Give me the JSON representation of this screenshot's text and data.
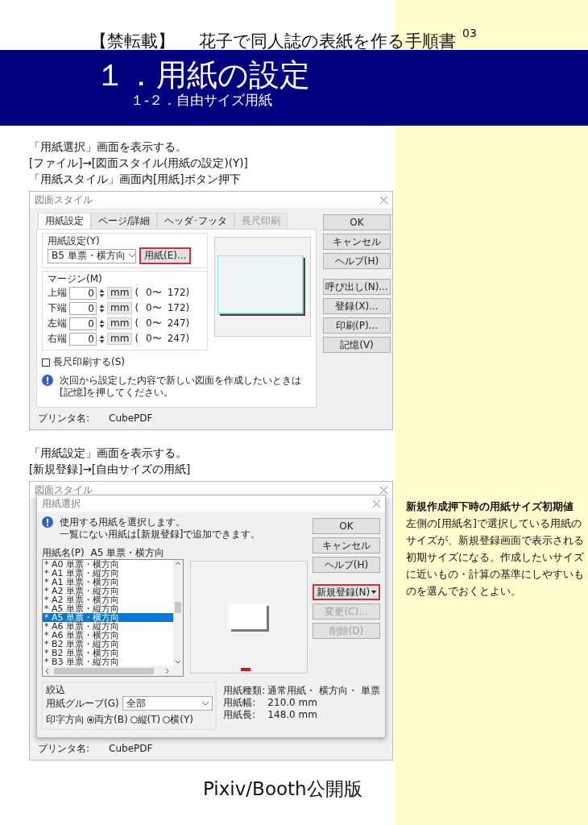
{
  "header": {
    "tag": "【禁転載】",
    "title": "花子で同人誌の表紙を作る手順書",
    "page_number": "03",
    "heading": "１．用紙の設定",
    "subheading": "１-２．自由サイズ用紙"
  },
  "section_1": {
    "instructions": [
      "「用紙選択」画面を表示する。",
      "[ファイル]→[図面スタイル(用紙の設定)(Y)]",
      "「用紙スタイル」画面内[用紙]ボタン押下"
    ],
    "dialog": {
      "title": "図面スタイル",
      "tabs": [
        {
          "label": "用紙設定",
          "selected": true,
          "disabled": false
        },
        {
          "label": "ページ/詳細",
          "selected": false,
          "disabled": false
        },
        {
          "label": "ヘッダ･フッタ",
          "selected": false,
          "disabled": false
        },
        {
          "label": "長尺印刷",
          "selected": false,
          "disabled": true
        }
      ],
      "paper_group": "用紙設定(Y)",
      "paper_value": "B5 単票・横方向",
      "paper_button": {
        "label": "用紙(E)...",
        "highlighted": true
      },
      "margin_group": "マージン(M)",
      "margins": [
        {
          "label": "上端",
          "value": "0",
          "unit": "mm",
          "paren": "(",
          "min": "0〜",
          "max": "172)"
        },
        {
          "label": "下端",
          "value": "0",
          "unit": "mm",
          "paren": "(",
          "min": "0〜",
          "max": "172)"
        },
        {
          "label": "左端",
          "value": "0",
          "unit": "mm",
          "paren": "(",
          "min": "0〜",
          "max": "247)"
        },
        {
          "label": "右端",
          "value": "0",
          "unit": "mm",
          "paren": "(",
          "min": "0〜",
          "max": "247)"
        }
      ],
      "checkbox": {
        "label": "長尺印刷する(S)",
        "checked": false
      },
      "info": "次回から設定した内容で新しい図面を作成したいときは[記憶]を押してください。",
      "buttons": [
        "OK",
        "キャンセル",
        "ヘルプ(H)"
      ],
      "buttons_2": [
        "呼び出し(N)...",
        "登録(X)...",
        "印刷(P)...",
        "記憶(V)"
      ],
      "printer_label": "プリンタ名:",
      "printer": "CubePDF"
    }
  },
  "section_2": {
    "instructions": [
      "「用紙設定」画面を表示する。",
      "[新規登録]→[自由サイズの用紙]"
    ],
    "back_dialog": {
      "title": "図面スタイル",
      "printer_label": "プリンタ名:",
      "printer": "CubePDF"
    },
    "dialog": {
      "title": "用紙選択",
      "info": [
        "使用する用紙を選択します。",
        "一覧にない用紙は[新規登録]で追加できます。"
      ],
      "list_label": "用紙名(P)",
      "list_current": "A5 単票・横方向",
      "papers": [
        {
          "label": "* A0 単票・横方向",
          "selected": false
        },
        {
          "label": "* A1 単票・縦方向",
          "selected": false
        },
        {
          "label": "* A1 単票・横方向",
          "selected": false
        },
        {
          "label": "* A2 単票・縦方向",
          "selected": false
        },
        {
          "label": "* A2 単票・横方向",
          "selected": false
        },
        {
          "label": "* A5 単票・縦方向",
          "selected": false
        },
        {
          "label": "* A5 単票・横方向",
          "selected": true
        },
        {
          "label": "* A6 単票・縦方向",
          "selected": false
        },
        {
          "label": "* A6 単票・横方向",
          "selected": false
        },
        {
          "label": "* B2 単票・縦方向",
          "selected": false
        },
        {
          "label": "* B2 単票・横方向",
          "selected": false
        },
        {
          "label": "* B3 単票・縦方向",
          "selected": false
        }
      ],
      "buttons": [
        {
          "label": "OK",
          "disabled": false,
          "highlighted": false,
          "dropdown": false
        },
        {
          "label": "キャンセル",
          "disabled": false,
          "highlighted": false,
          "dropdown": false
        },
        {
          "label": "ヘルプ(H)",
          "disabled": false,
          "highlighted": false,
          "dropdown": false
        },
        {
          "label": "新規登録(N)",
          "disabled": false,
          "highlighted": true,
          "dropdown": true
        },
        {
          "label": "変更(C)...",
          "disabled": true,
          "highlighted": false,
          "dropdown": false
        },
        {
          "label": "削除(D)",
          "disabled": true,
          "highlighted": false,
          "dropdown": false
        }
      ],
      "filter_group": "絞込",
      "group_label": "用紙グループ(G)",
      "group_value": "全部",
      "direction_label": "印字方向",
      "directions": [
        {
          "label": "両方(B)",
          "selected": true
        },
        {
          "label": "縦(T)",
          "selected": false
        },
        {
          "label": "横(Y)",
          "selected": false
        }
      ],
      "details": [
        {
          "label": "用紙種類:",
          "value": "通常用紙・ 横方向・ 単票"
        },
        {
          "label": "用紙幅:",
          "value": "210.0 mm"
        },
        {
          "label": "用紙長:",
          "value": "148.0 mm"
        }
      ]
    }
  },
  "note": {
    "title": "新規作成押下時の用紙サイズ初期値",
    "body": "左側の[用紙名]で選択している用紙のサイズが、新規登録画面で表示される初期サイズになる。作成したいサイズに近いもの・計算の基準にしやすいものを選んでおくとよい。"
  },
  "footer": "Pixiv/Booth公開版"
}
